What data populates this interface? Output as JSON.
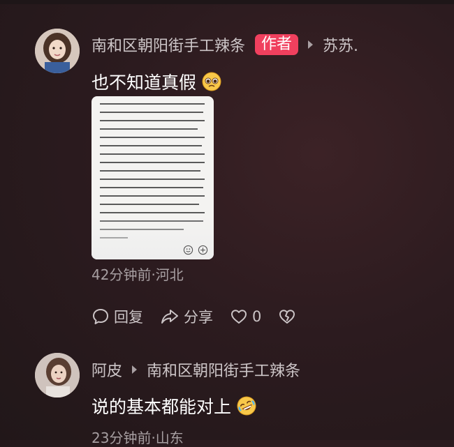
{
  "comments": [
    {
      "username": "南和区朝阳街手工辣条",
      "author_badge": "作者",
      "reply_to": "苏苏.",
      "text": "也不知道真假",
      "emoji_icon": "pleading-face-emoji",
      "has_image": true,
      "time_location": "42分钟前·河北",
      "actions": {
        "reply_label": "回复",
        "share_label": "分享",
        "like_count": "0"
      }
    },
    {
      "username": "阿皮",
      "reply_to": "南和区朝阳街手工辣条",
      "text": "说的基本都能对上",
      "emoji_icon": "rofl-emoji",
      "time_location": "23分钟前·山东"
    }
  ],
  "colors": {
    "author_badge": "#f0405e",
    "background": "#2c1b1f",
    "secondary_text": "#a79fa2"
  }
}
